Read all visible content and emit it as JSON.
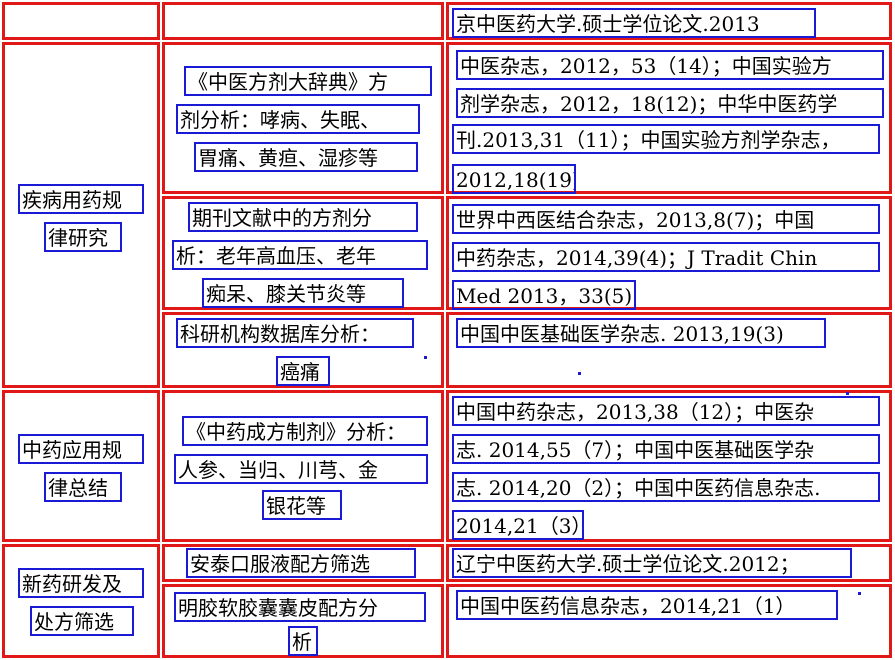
{
  "rows": [
    {
      "category": [],
      "method": [],
      "source": [
        "京中医药大学.硕士学位论文.2013"
      ]
    },
    {
      "category": [
        "疾病用药规",
        "律研究"
      ],
      "subrows": [
        {
          "method": [
            "《中医方剂大辞典》方",
            "剂分析：哮病、失眠、",
            "胃痛、黄疸、湿疹等"
          ],
          "source": [
            "中医杂志，2012，53（14）；中国实验方",
            "剂学杂志，2012，18(12)；中华中医药学",
            "刊.2013,31（11）；中国实验方剂学杂志，",
            "2012,18(19)"
          ]
        },
        {
          "method": [
            "期刊文献中的方剂分",
            "析：老年高血压、老年",
            "痴呆、膝关节炎等"
          ],
          "source": [
            "世界中西医结合杂志，2013,8(7)；中国",
            "中药杂志，2014,39(4)；J Tradit Chin",
            "Med 2013，33(5)"
          ]
        },
        {
          "method": [
            "科研机构数据库分析：",
            "癌痛"
          ],
          "source": [
            "中国中医基础医学杂志. 2013,19(3)"
          ]
        }
      ]
    },
    {
      "category": [
        "中药应用规",
        "律总结"
      ],
      "method": [
        "《中药成方制剂》分析：",
        "人参、当归、川芎、金",
        "银花等"
      ],
      "source": [
        "中国中药杂志，2013,38（12）；中医杂",
        "志. 2014,55（7）；中国中医基础医学杂",
        "志. 2014,20（2）；中国中医药信息杂志.",
        "2014,21（3）"
      ]
    },
    {
      "category": [
        "新药研发及",
        "处方筛选"
      ],
      "subrows": [
        {
          "method": [
            "安泰口服液配方筛选"
          ],
          "source": [
            "辽宁中医药大学.硕士学位论文.2012；"
          ]
        },
        {
          "method": [
            "明胶软胶囊囊皮配方分",
            "析"
          ],
          "source": [
            "中国中医药信息杂志，2014,21（1）"
          ]
        }
      ]
    }
  ]
}
